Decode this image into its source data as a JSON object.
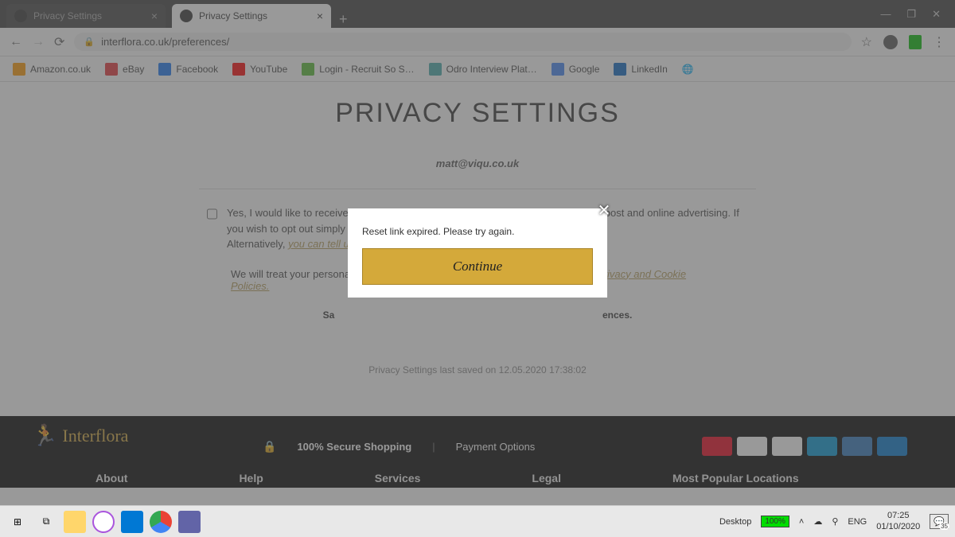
{
  "titlebar": {
    "tabs": [
      {
        "title": "Privacy Settings"
      },
      {
        "title": "Privacy Settings"
      }
    ]
  },
  "address": {
    "url": "interflora.co.uk/preferences/"
  },
  "bookmarks": [
    {
      "label": "Amazon.co.uk",
      "color": "#ff9900"
    },
    {
      "label": "eBay",
      "color": "#e53238"
    },
    {
      "label": "Facebook",
      "color": "#1877f2"
    },
    {
      "label": "YouTube",
      "color": "#ff0000"
    },
    {
      "label": "Login - Recruit So S…",
      "color": "#5b3"
    },
    {
      "label": "Odro Interview Plat…",
      "color": "#4aa"
    },
    {
      "label": "Google",
      "color": "#4285f4"
    },
    {
      "label": "LinkedIn",
      "color": "#0a66c2"
    }
  ],
  "page": {
    "title": "PRIVACY SETTINGS",
    "email": "matt@viqu.co.uk",
    "consent_text": "Yes, I would like to receive offers, updates and marketing from Interflora via email, post and online advertising. If you wish to opt out simply untick the pre-ticked box.",
    "alt_prefix": "Alternatively, ",
    "alt_link": "you can tell us how you'd like to hear from us.",
    "policy_prefix": "We will treat your personal information with respect and use it as detailed in our ",
    "policy_link": "Privacy and Cookie Policies.",
    "save_hint_left": "Sa",
    "save_hint_right": "ences.",
    "last_saved": "Privacy Settings last saved on 12.05.2020 17:38:02"
  },
  "modal": {
    "message": "Reset link expired. Please try again.",
    "button": "Continue"
  },
  "footer": {
    "brand": "Interflora",
    "secure": "100% Secure Shopping",
    "payment_label": "Payment Options",
    "cols": [
      "About",
      "Help",
      "Services",
      "Legal",
      "Most Popular Locations"
    ]
  },
  "taskbar": {
    "desktop_label": "Desktop",
    "battery": "100%",
    "lang": "ENG",
    "time": "07:25",
    "date": "01/10/2020",
    "notif": "35"
  }
}
